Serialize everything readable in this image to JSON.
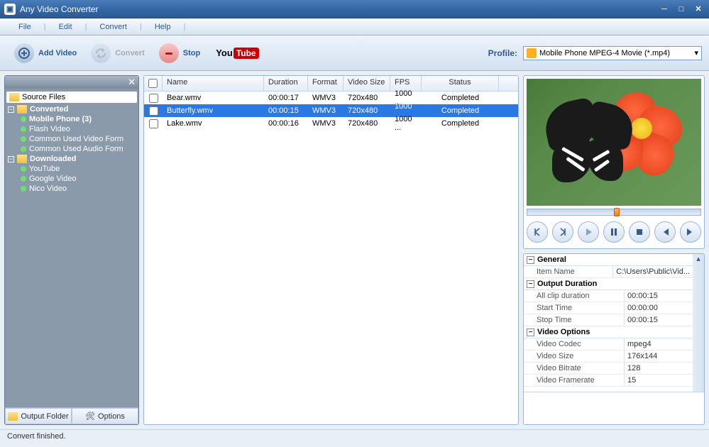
{
  "window": {
    "title": "Any Video Converter"
  },
  "menu": {
    "items": [
      "File",
      "Edit",
      "Convert",
      "Help"
    ]
  },
  "toolbar": {
    "add_label": "Add Video",
    "convert_label": "Convert",
    "stop_label": "Stop",
    "profile_label": "Profile:",
    "profile_selected": "Mobile Phone MPEG-4 Movie (*.mp4)"
  },
  "sidebar": {
    "root": "Source Files",
    "groups": [
      {
        "label": "Converted",
        "expanded": true,
        "children": [
          {
            "label": "Mobile Phone (3)",
            "bold": true
          },
          {
            "label": "Flash Video"
          },
          {
            "label": "Common Used Video Form"
          },
          {
            "label": "Common Used Audio Form"
          }
        ]
      },
      {
        "label": "Downloaded",
        "expanded": true,
        "children": [
          {
            "label": "YouTube"
          },
          {
            "label": "Google Video"
          },
          {
            "label": "Nico Video"
          }
        ]
      }
    ],
    "footer": {
      "output_folder": "Output Folder",
      "options": "Options"
    }
  },
  "grid": {
    "headers": {
      "name": "Name",
      "duration": "Duration",
      "format": "Format",
      "video_size": "Video Size",
      "fps": "FPS",
      "status": "Status"
    },
    "rows": [
      {
        "name": "Bear.wmv",
        "duration": "00:00:17",
        "format": "WMV3",
        "video_size": "720x480",
        "fps": "1000 ...",
        "status": "Completed",
        "selected": false
      },
      {
        "name": "Butterfly.wmv",
        "duration": "00:00:15",
        "format": "WMV3",
        "video_size": "720x480",
        "fps": "1000 ...",
        "status": "Completed",
        "selected": true
      },
      {
        "name": "Lake.wmv",
        "duration": "00:00:16",
        "format": "WMV3",
        "video_size": "720x480",
        "fps": "1000 ...",
        "status": "Completed",
        "selected": false
      }
    ]
  },
  "props": {
    "sections": [
      {
        "title": "General",
        "rows": [
          {
            "key": "Item Name",
            "val": "C:\\Users\\Public\\Vid..."
          }
        ]
      },
      {
        "title": "Output Duration",
        "rows": [
          {
            "key": "All clip duration",
            "val": "00:00:15"
          },
          {
            "key": "Start Time",
            "val": "00:00:00"
          },
          {
            "key": "Stop Time",
            "val": "00:00:15"
          }
        ]
      },
      {
        "title": "Video Options",
        "rows": [
          {
            "key": "Video Codec",
            "val": "mpeg4"
          },
          {
            "key": "Video Size",
            "val": "176x144"
          },
          {
            "key": "Video Bitrate",
            "val": "128"
          },
          {
            "key": "Video Framerate",
            "val": "15"
          }
        ]
      }
    ]
  },
  "status": {
    "text": "Convert finished."
  }
}
